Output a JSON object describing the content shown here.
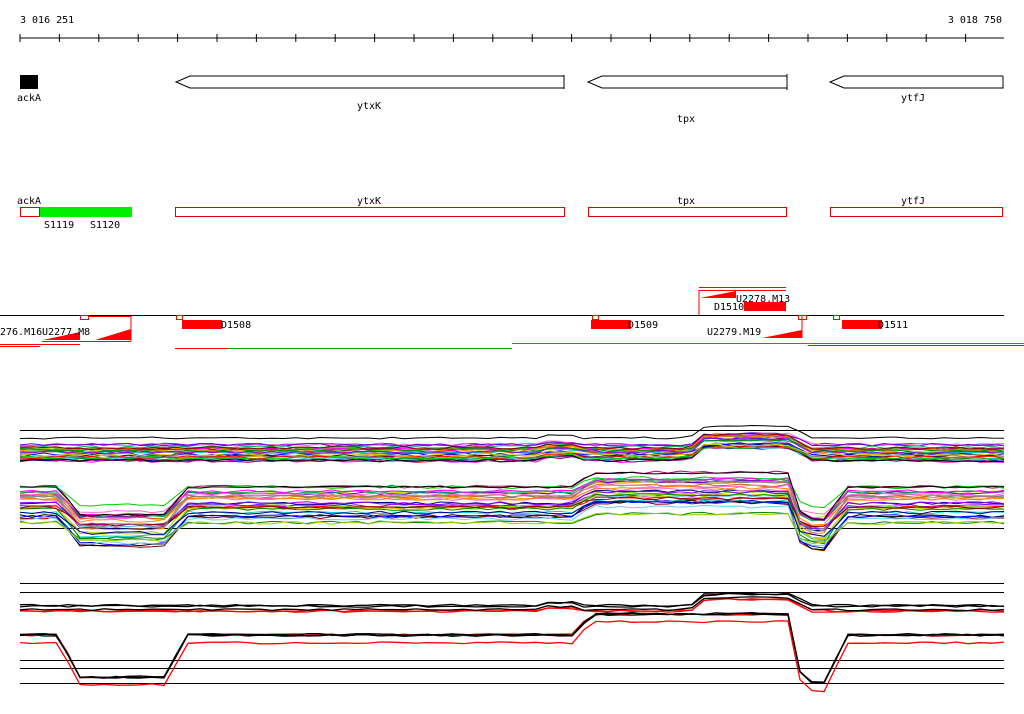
{
  "ruler": {
    "start_label": "3 016 251",
    "end_label": "3 018 750"
  },
  "genes": [
    {
      "name": "ackA",
      "strand": "+",
      "style": "filled"
    },
    {
      "name": "ytxK",
      "strand": "-",
      "style": "arrow"
    },
    {
      "name": "tpx",
      "strand": "-",
      "style": "arrow"
    },
    {
      "name": "ytfJ",
      "strand": "-",
      "style": "arrow"
    }
  ],
  "gene_track_labels": [
    "ackA",
    "ytxK",
    "tpx",
    "ytfJ"
  ],
  "segments": [
    {
      "label": "S1119",
      "color": "#00ee00"
    },
    {
      "label": "S1120",
      "color": "#00ee00"
    }
  ],
  "features": {
    "downstream": [
      "D1508",
      "D1509",
      "D1510",
      "D1511"
    ],
    "upstream": [
      "276.M16",
      "U2277.M8",
      "U2278.M13",
      "U2279.M19"
    ]
  },
  "colors": {
    "feature": "#ff0000",
    "segment": "#00ee00",
    "outline": "#000000",
    "gene_track_outline": "#dd0000"
  },
  "expression": {
    "panel_a_lines": 60,
    "panel_b_lines": 10
  }
}
